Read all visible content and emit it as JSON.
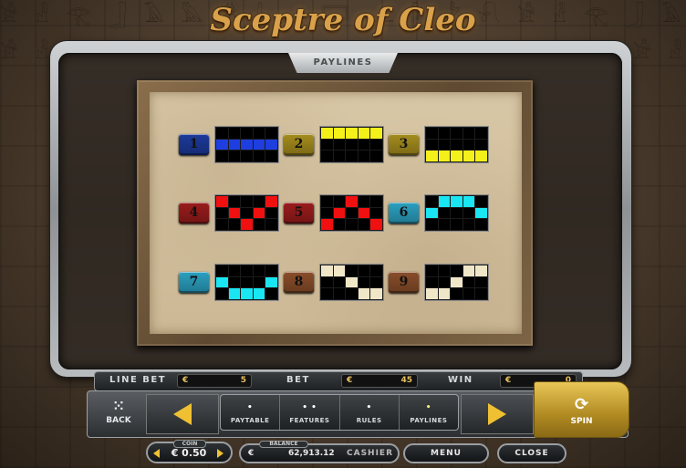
{
  "game": {
    "title": "Sceptre of Cleo"
  },
  "panel": {
    "tab_label": "PAYLINES"
  },
  "paylines": [
    {
      "number": "1",
      "color": "#1e3ee0",
      "badge": "#1c3a9a",
      "rows": [
        [
          0,
          0,
          0,
          0,
          0
        ],
        [
          1,
          1,
          1,
          1,
          1
        ],
        [
          0,
          0,
          0,
          0,
          0
        ]
      ]
    },
    {
      "number": "2",
      "color": "#f4f01a",
      "badge": "#a58d1d",
      "rows": [
        [
          1,
          1,
          1,
          1,
          1
        ],
        [
          0,
          0,
          0,
          0,
          0
        ],
        [
          0,
          0,
          0,
          0,
          0
        ]
      ]
    },
    {
      "number": "3",
      "color": "#f4f01a",
      "badge": "#a58d1d",
      "rows": [
        [
          0,
          0,
          0,
          0,
          0
        ],
        [
          0,
          0,
          0,
          0,
          0
        ],
        [
          1,
          1,
          1,
          1,
          1
        ]
      ]
    },
    {
      "number": "4",
      "color": "#f01010",
      "badge": "#9a1c1c",
      "rows": [
        [
          1,
          0,
          0,
          0,
          1
        ],
        [
          0,
          1,
          0,
          1,
          0
        ],
        [
          0,
          0,
          1,
          0,
          0
        ]
      ]
    },
    {
      "number": "5",
      "color": "#f01010",
      "badge": "#9a1c1c",
      "rows": [
        [
          0,
          0,
          1,
          0,
          0
        ],
        [
          0,
          1,
          0,
          1,
          0
        ],
        [
          1,
          0,
          0,
          0,
          1
        ]
      ]
    },
    {
      "number": "6",
      "color": "#19e6f2",
      "badge": "#2ba0c0",
      "rows": [
        [
          0,
          1,
          1,
          1,
          0
        ],
        [
          1,
          0,
          0,
          0,
          1
        ],
        [
          0,
          0,
          0,
          0,
          0
        ]
      ]
    },
    {
      "number": "7",
      "color": "#19e6f2",
      "badge": "#2ba0c0",
      "rows": [
        [
          0,
          0,
          0,
          0,
          0
        ],
        [
          1,
          0,
          0,
          0,
          1
        ],
        [
          0,
          1,
          1,
          1,
          0
        ]
      ]
    },
    {
      "number": "8",
      "color": "#f0e6c8",
      "badge": "#8a4e2a",
      "rows": [
        [
          1,
          1,
          0,
          0,
          0
        ],
        [
          0,
          0,
          1,
          0,
          0
        ],
        [
          0,
          0,
          0,
          1,
          1
        ]
      ]
    },
    {
      "number": "9",
      "color": "#f0e6c8",
      "badge": "#8a4e2a",
      "rows": [
        [
          0,
          0,
          0,
          1,
          1
        ],
        [
          0,
          0,
          1,
          0,
          0
        ],
        [
          1,
          1,
          0,
          0,
          0
        ]
      ]
    }
  ],
  "stats": {
    "line_bet_label": "LINE BET",
    "line_bet_currency": "€",
    "line_bet_value": "5",
    "bet_label": "BET",
    "bet_currency": "€",
    "bet_value": "45",
    "win_label": "WIN",
    "win_currency": "€",
    "win_value": "0"
  },
  "controls": {
    "back_label": "BACK",
    "tabs": [
      {
        "dots": "•",
        "label": "PAYTABLE",
        "active": false
      },
      {
        "dots": "• •",
        "label": "FEATURES",
        "active": false
      },
      {
        "dots": "•",
        "label": "RULES",
        "active": false
      },
      {
        "dots": "•",
        "label": "PAYLINES",
        "active": true
      }
    ],
    "spin_label": "SPIN"
  },
  "footer": {
    "coin_caption": "COIN",
    "coin_value": "€ 0.50",
    "balance_caption": "BALANCE",
    "balance_currency": "€",
    "balance_value": "62,913.12",
    "cashier_label": "CASHIER",
    "menu_label": "MENU",
    "close_label": "CLOSE"
  },
  "colors": {
    "accent": "#f0c033",
    "gold": "#d9a14a"
  }
}
